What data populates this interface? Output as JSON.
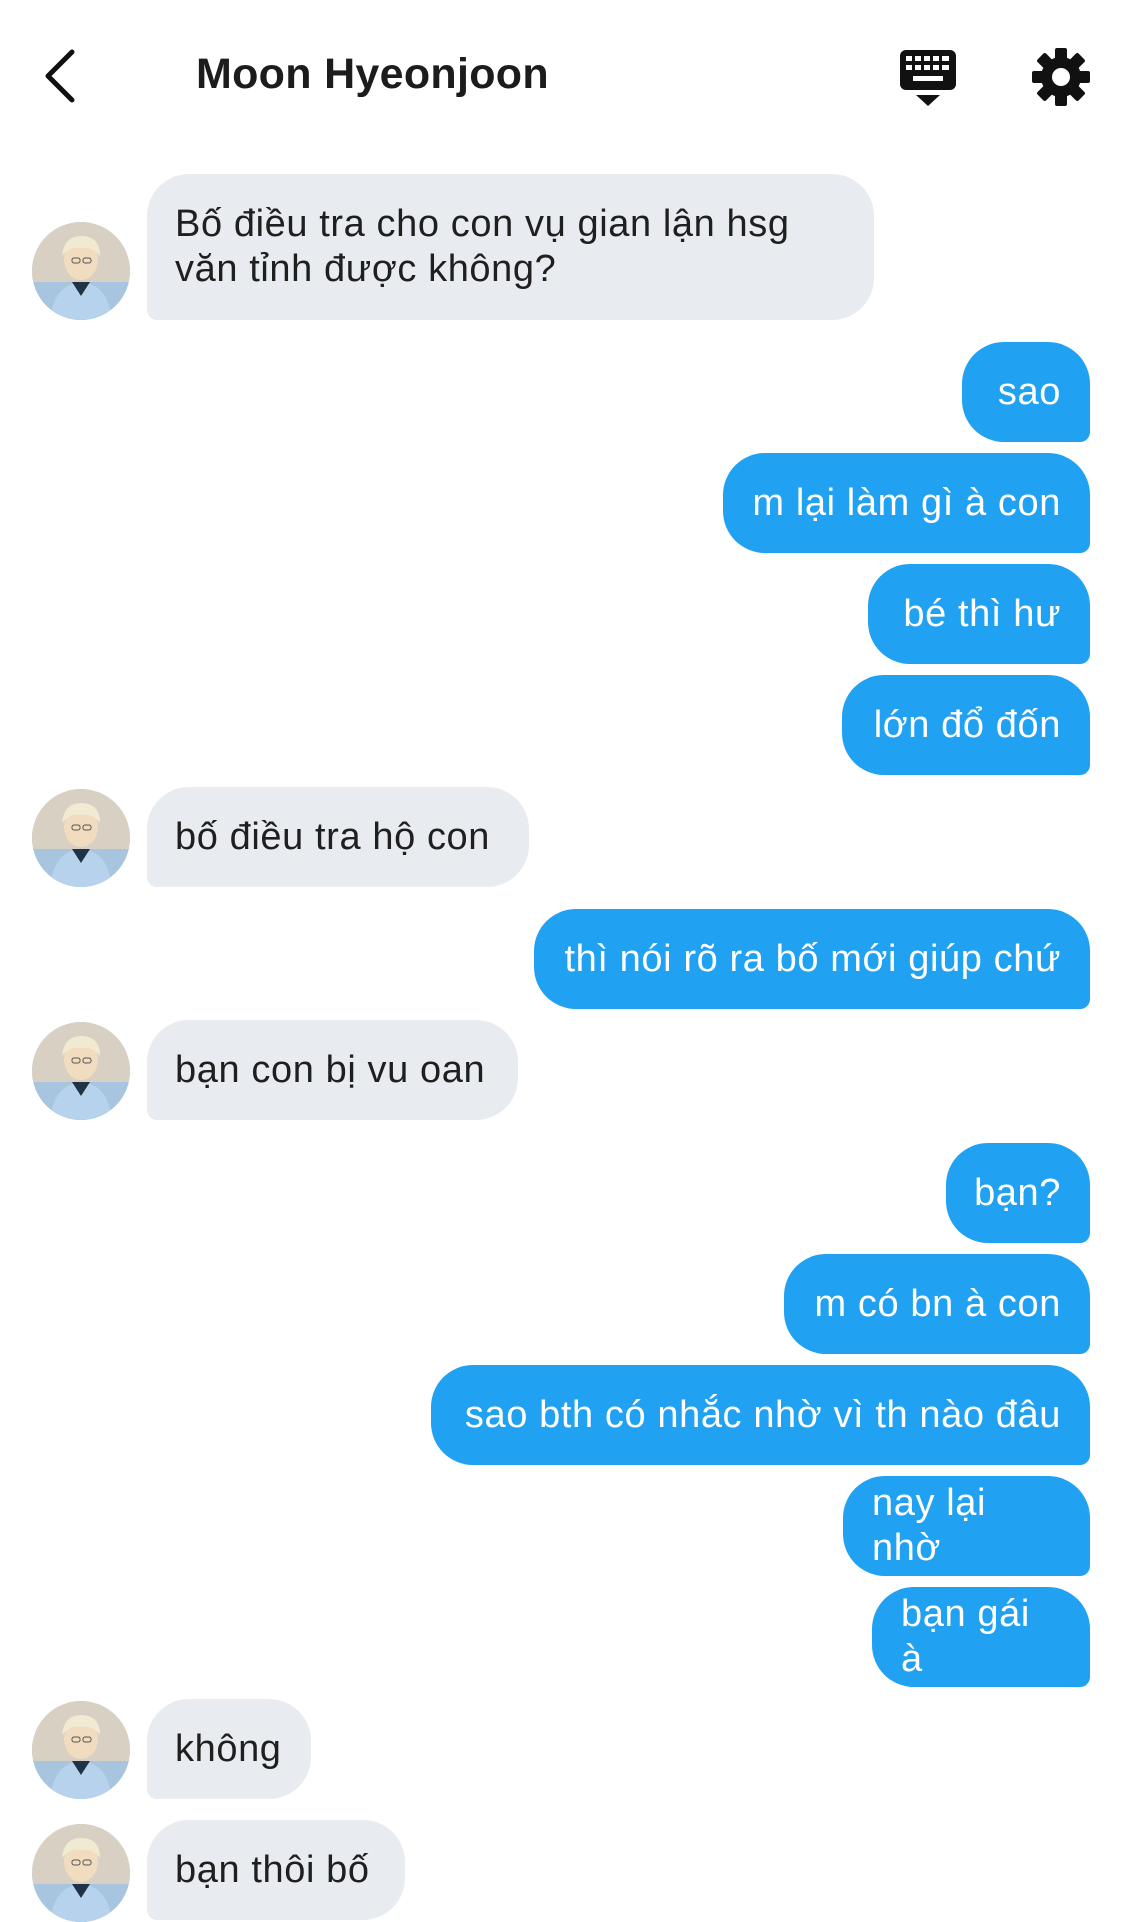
{
  "header": {
    "title": "Moon Hyeonjoon"
  },
  "messages": [
    {
      "from": "them",
      "text": "Bố điều tra cho con vụ gian lận hsg văn tỉnh được không?"
    },
    {
      "from": "me",
      "text": "sao"
    },
    {
      "from": "me",
      "text": "m lại làm gì à con"
    },
    {
      "from": "me",
      "text": "bé thì hư"
    },
    {
      "from": "me",
      "text": "lớn đổ đốn"
    },
    {
      "from": "them",
      "text": "bố điều tra hộ con"
    },
    {
      "from": "me",
      "text": "thì nói rõ ra bố mới giúp chứ"
    },
    {
      "from": "them",
      "text": "bạn con bị vu oan"
    },
    {
      "from": "me",
      "text": "bạn?"
    },
    {
      "from": "me",
      "text": "m có bn à con"
    },
    {
      "from": "me",
      "text": "sao bth có nhắc nhờ vì th nào đâu"
    },
    {
      "from": "me",
      "text": "nay lại nhờ"
    },
    {
      "from": "me",
      "text": "bạn gái à"
    },
    {
      "from": "them",
      "text": "không"
    },
    {
      "from": "them",
      "text": "bạn thôi bố"
    }
  ],
  "colors": {
    "outgoing_bubble": "#21a1f1",
    "incoming_bubble": "#e8ecf1"
  }
}
